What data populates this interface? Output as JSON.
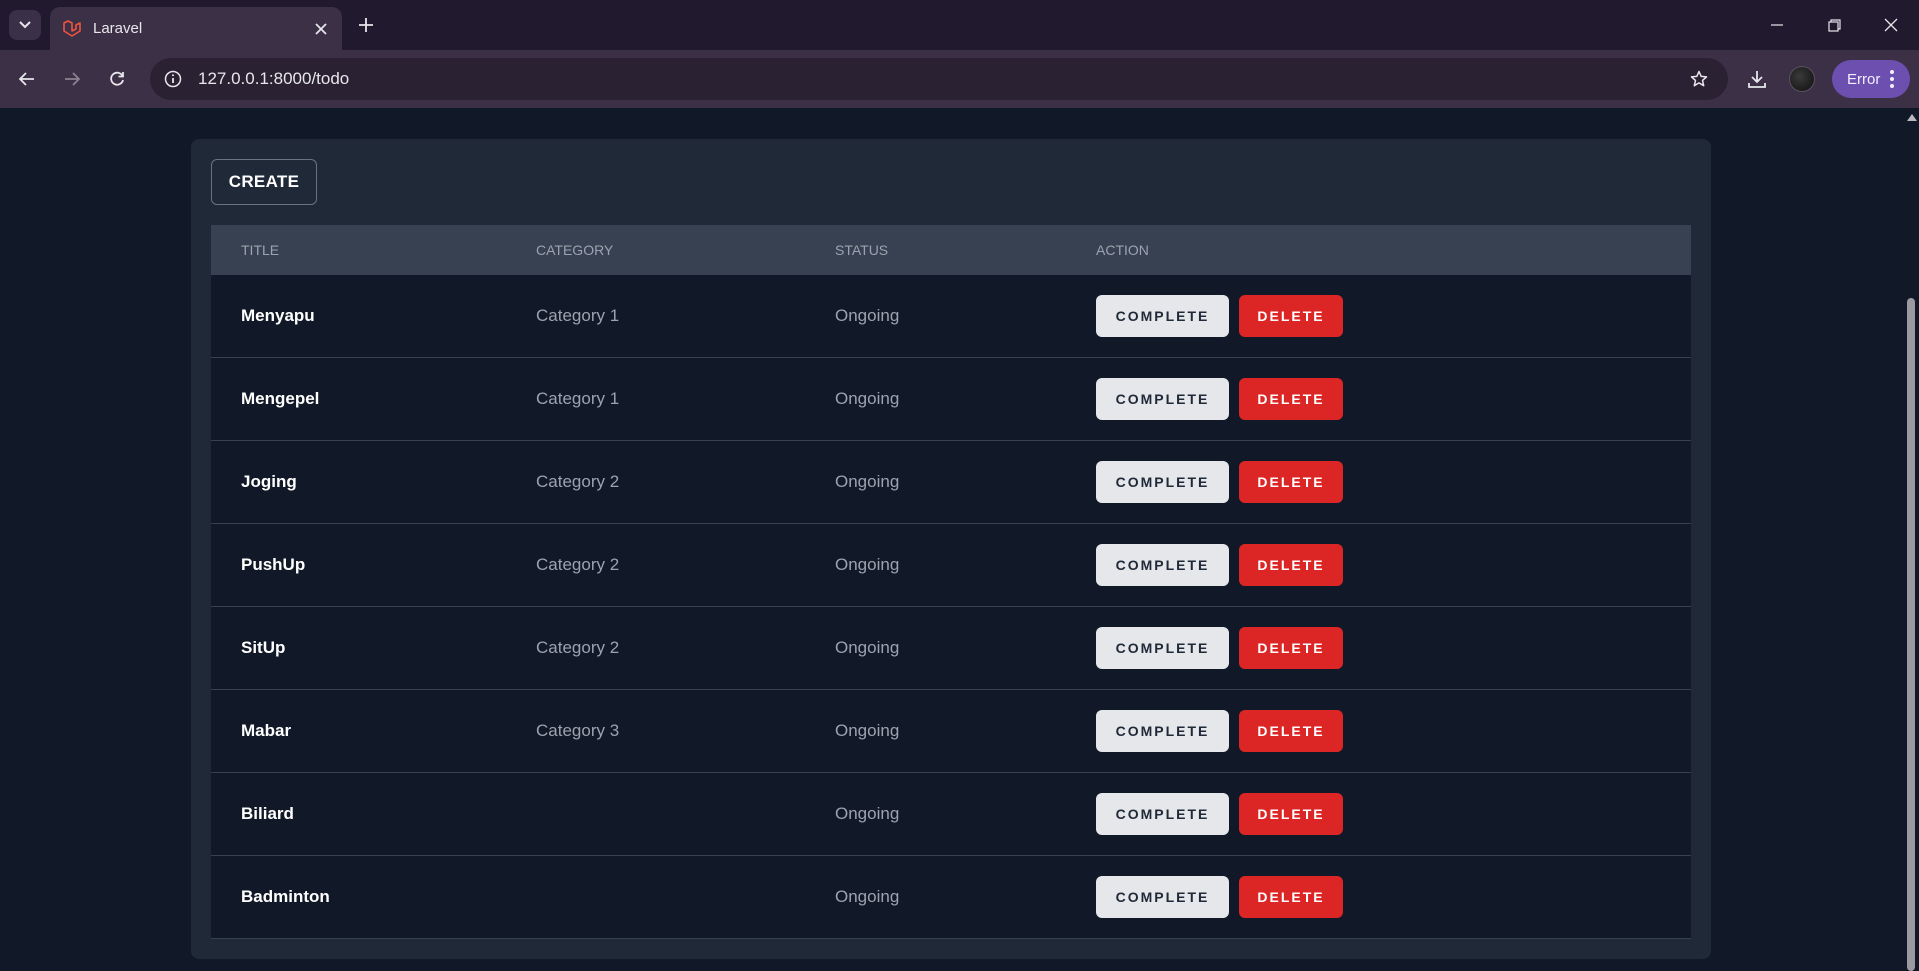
{
  "browser": {
    "tab_title": "Laravel",
    "url": "127.0.0.1:8000/todo",
    "profile_status": "Error"
  },
  "page": {
    "create_label": "CREATE",
    "columns": [
      "TITLE",
      "CATEGORY",
      "STATUS",
      "ACTION"
    ],
    "complete_label": "COMPLETE",
    "delete_label": "DELETE",
    "rows": [
      {
        "title": "Menyapu",
        "category": "Category 1",
        "status": "Ongoing"
      },
      {
        "title": "Mengepel",
        "category": "Category 1",
        "status": "Ongoing"
      },
      {
        "title": "Joging",
        "category": "Category 2",
        "status": "Ongoing"
      },
      {
        "title": "PushUp",
        "category": "Category 2",
        "status": "Ongoing"
      },
      {
        "title": "SitUp",
        "category": "Category 2",
        "status": "Ongoing"
      },
      {
        "title": "Mabar",
        "category": "Category 3",
        "status": "Ongoing"
      },
      {
        "title": "Biliard",
        "category": "",
        "status": "Ongoing"
      },
      {
        "title": "Badminton",
        "category": "",
        "status": "Ongoing"
      }
    ]
  },
  "colors": {
    "page_bg": "#111827",
    "card_bg": "#1f2937",
    "header_bg": "#374151",
    "delete_red": "#dc2626",
    "complete_gray": "#e5e7eb",
    "browser_frame": "#3b3046"
  }
}
